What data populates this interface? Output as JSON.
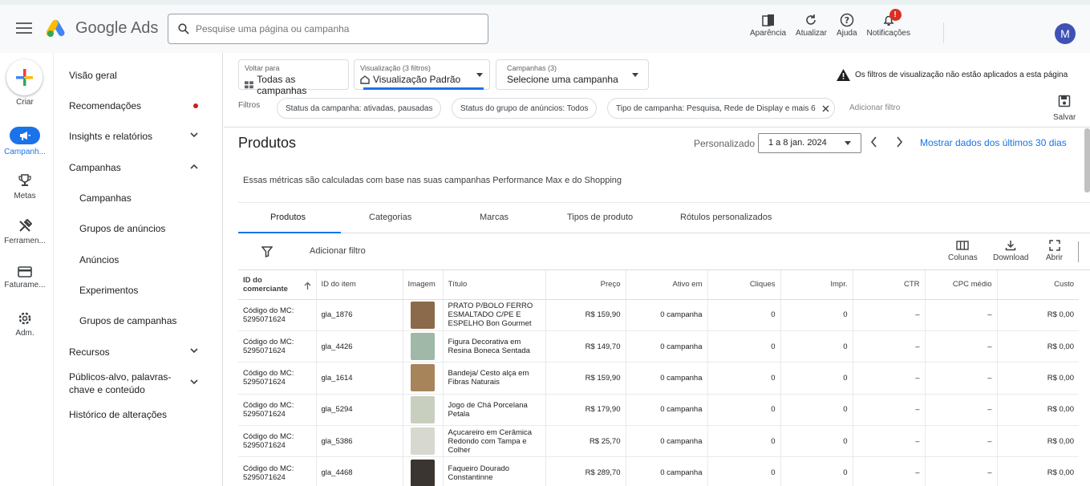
{
  "header": {
    "brand": "Google Ads",
    "search_placeholder": "Pesquise uma página ou campanha",
    "actions": [
      "Aparência",
      "Atualizar",
      "Ajuda",
      "Notificações"
    ],
    "notification_count": "!",
    "avatar_initial": "M"
  },
  "rail": {
    "items": [
      "Criar",
      "Campanh...",
      "Metas",
      "Ferramen...",
      "Faturame...",
      "Adm."
    ]
  },
  "nav": {
    "items": [
      "Visão geral",
      "Recomendações",
      "Insights e relatórios",
      "Campanhas",
      "Campanhas",
      "Grupos de anúncios",
      "Anúncios",
      "Experimentos",
      "Grupos de campanhas",
      "Recursos",
      "Públicos-alvo, palavras-",
      "chave e conteúdo",
      "Histórico de alterações"
    ]
  },
  "selectors": {
    "back_label": "Voltar para",
    "back_value": "Todas as campanhas",
    "view_label": "Visualização (3 filtros)",
    "view_value": "Visualização Padrão",
    "campaign_label": "Campanhas (3)",
    "campaign_value": "Selecione uma campanha"
  },
  "warning_text": "Os filtros de visualização não estão aplicados a esta página",
  "filters": {
    "label": "Filtros",
    "chips": [
      "Status da campanha: ativadas, pausadas",
      "Status do grupo de anúncios: Todos",
      "Tipo de campanha: Pesquisa, Rede de Display e mais 6"
    ],
    "add_filter": "Adicionar filtro",
    "save": "Salvar"
  },
  "page": {
    "title": "Produtos",
    "custom_label": "Personalizado",
    "date_range": "1 a 8 jan. 2024",
    "last_30": "Mostrar dados dos últimos 30 dias",
    "info": "Essas métricas são calculadas com base nas suas campanhas Performance Max e do Shopping"
  },
  "tabs": [
    "Produtos",
    "Categorias",
    "Marcas",
    "Tipos de produto",
    "Rótulos personalizados"
  ],
  "toolbar": {
    "add_filter": "Adicionar filtro",
    "columns": "Colunas",
    "download": "Download",
    "open": "Abrir"
  },
  "table": {
    "headers": [
      "ID do comerciante",
      "ID do item",
      "Imagem",
      "Título",
      "Preço",
      "Ativo em",
      "Cliques",
      "Impr.",
      "CTR",
      "CPC médio",
      "Custo"
    ],
    "rows": [
      {
        "merchant": "Código do MC: 5295071624",
        "item": "gla_1876",
        "title": "PRATO P/BOLO FERRO ESMALTADO C/PE E ESPELHO Bon Gourmet",
        "price": "R$ 159,90",
        "active": "0 campanha",
        "clicks": "0",
        "impr": "0",
        "ctr": "–",
        "cpc": "–",
        "cost": "R$ 0,00",
        "thumb_color": "#8a6a4a"
      },
      {
        "merchant": "Código do MC: 5295071624",
        "item": "gla_4426",
        "title": "Figura Decorativa em Resina Boneca Sentada",
        "price": "R$ 149,70",
        "active": "0 campanha",
        "clicks": "0",
        "impr": "0",
        "ctr": "–",
        "cpc": "–",
        "cost": "R$ 0,00",
        "thumb_color": "#9fb8a8"
      },
      {
        "merchant": "Código do MC: 5295071624",
        "item": "gla_1614",
        "title": "Bandeja/ Cesto alça em Fibras Naturais",
        "price": "R$ 159,90",
        "active": "0 campanha",
        "clicks": "0",
        "impr": "0",
        "ctr": "–",
        "cpc": "–",
        "cost": "R$ 0,00",
        "thumb_color": "#a8845a"
      },
      {
        "merchant": "Código do MC: 5295071624",
        "item": "gla_5294",
        "title": "Jogo de Chá Porcelana Petala",
        "price": "R$ 179,90",
        "active": "0 campanha",
        "clicks": "0",
        "impr": "0",
        "ctr": "–",
        "cpc": "–",
        "cost": "R$ 0,00",
        "thumb_color": "#c9cfbf"
      },
      {
        "merchant": "Código do MC: 5295071624",
        "item": "gla_5386",
        "title": "Açucareiro em Cerâmica Redondo com Tampa e Colher",
        "price": "R$ 25,70",
        "active": "0 campanha",
        "clicks": "0",
        "impr": "0",
        "ctr": "–",
        "cpc": "–",
        "cost": "R$ 0,00",
        "thumb_color": "#d7d8cf"
      },
      {
        "merchant": "Código do MC: 5295071624",
        "item": "gla_4468",
        "title": "Faqueiro Dourado Constantinne",
        "price": "R$ 289,70",
        "active": "0 campanha",
        "clicks": "0",
        "impr": "0",
        "ctr": "–",
        "cpc": "–",
        "cost": "R$ 0,00",
        "thumb_color": "#3a3530"
      }
    ]
  },
  "colors": {
    "accent": "#1a73e8",
    "alert": "#d93025"
  }
}
